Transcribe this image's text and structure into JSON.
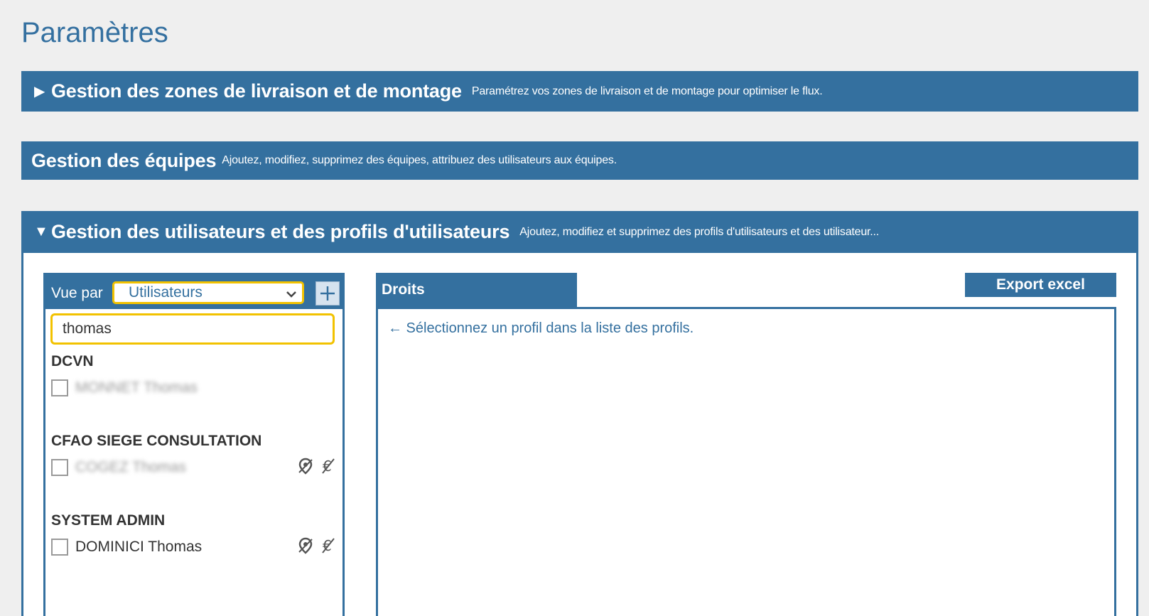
{
  "page_title": "Paramètres",
  "sections": {
    "delivery": {
      "arrow": "▶",
      "title": "Gestion des zones de livraison et de montage",
      "desc": "Paramétrez vos zones de livraison et de montage pour optimiser le flux."
    },
    "teams": {
      "title": "Gestion des équipes",
      "desc": "Ajoutez, modifiez, supprimez des équipes, attribuez des utilisateurs aux équipes."
    },
    "users": {
      "arrow": "▼",
      "title": "Gestion des utilisateurs et des profils d'utilisateurs",
      "desc": "Ajoutez, modifiez et supprimez des profils d'utilisateurs et des utilisateur..."
    }
  },
  "left_panel": {
    "vue_label": "Vue par",
    "vue_selected": "Utilisateurs",
    "search_value": "thomas",
    "groups": [
      {
        "name": "DCVN",
        "users": [
          {
            "name": "MONNET Thomas",
            "blurred": true,
            "icons": false
          }
        ]
      },
      {
        "name": "CFAO SIEGE CONSULTATION",
        "users": [
          {
            "name": "COGEZ Thomas",
            "blurred": true,
            "icons": true
          }
        ]
      },
      {
        "name": "SYSTEM ADMIN",
        "users": [
          {
            "name": "DOMINICI Thomas",
            "blurred": false,
            "icons": true
          }
        ]
      }
    ]
  },
  "rights": {
    "tab_label": "Droits",
    "hint": "← Sélectionnez un profil dans la liste des profils.",
    "export_label": "Export excel"
  },
  "colors": {
    "primary": "#34709f",
    "focus": "#f2c200",
    "background": "#efefef"
  }
}
